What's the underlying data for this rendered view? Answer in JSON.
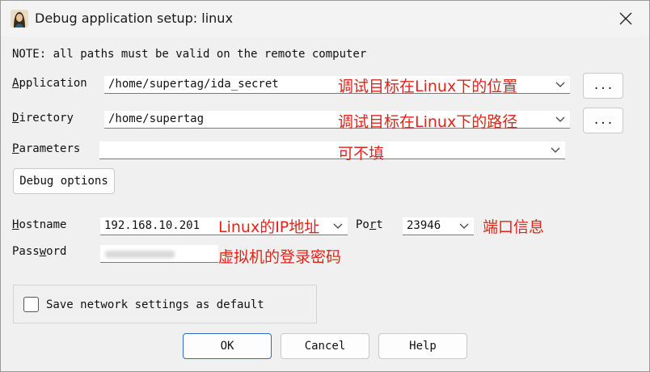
{
  "window": {
    "title": "Debug application setup: linux",
    "icon": "ida-portrait-icon"
  },
  "note": "NOTE: all paths must be valid on the remote computer",
  "fields": {
    "application": {
      "label_prefix": "",
      "label_ul": "A",
      "label_rest": "pplication",
      "value": "/home/supertag/ida_secret",
      "browse": "..."
    },
    "directory": {
      "label_ul": "D",
      "label_rest": "irectory",
      "value": "/home/supertag",
      "browse": "..."
    },
    "parameters": {
      "label_ul": "P",
      "label_rest": "arameters",
      "value": ""
    },
    "hostname": {
      "label_ul": "H",
      "label_rest": "ostname",
      "value": "192.168.10.201"
    },
    "port": {
      "label_prefix": "Po",
      "label_ul": "r",
      "label_rest": "t",
      "value": "23946"
    },
    "password": {
      "label_prefix": "Pass",
      "label_ul": "w",
      "label_rest": "ord"
    }
  },
  "buttons": {
    "debug_options": "Debug options",
    "ok": "OK",
    "cancel": "Cancel",
    "help": "Help"
  },
  "save_network": {
    "label": "Save network settings as default",
    "checked": false
  },
  "annotations": {
    "application": "调试目标在Linux下的位置",
    "directory": "调试目标在Linux下的路径",
    "parameters": "可不填",
    "hostname": "Linux的IP地址",
    "port": "端口信息",
    "password": "虚拟机的登录密码"
  },
  "colors": {
    "annotation": "#e0241a",
    "default_button_border": "#2a6ebf"
  }
}
